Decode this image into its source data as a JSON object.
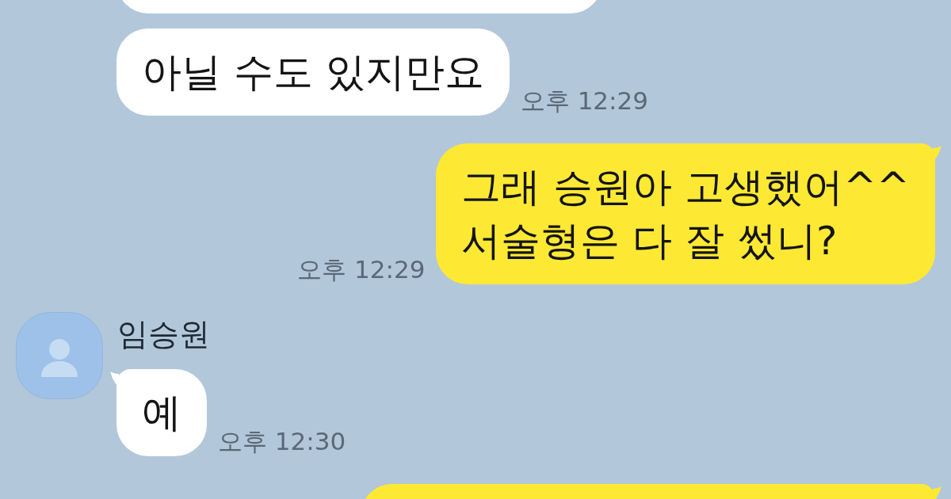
{
  "chat": {
    "messages": [
      {
        "kind": "received"
      },
      {
        "kind": "received",
        "tail": false,
        "text": "아닐 수도 있지만요",
        "time": "오후 12:29"
      },
      {
        "kind": "sent",
        "tail": true,
        "text": "그래 승원아 고생했어^^\n서술형은 다 잘 썼니?",
        "time": "오후 12:29"
      },
      {
        "kind": "received",
        "tail": true,
        "sender": "임승원",
        "text": "예",
        "time": "오후 12:30"
      },
      {
        "kind": "sent",
        "tail": true
      }
    ]
  }
}
